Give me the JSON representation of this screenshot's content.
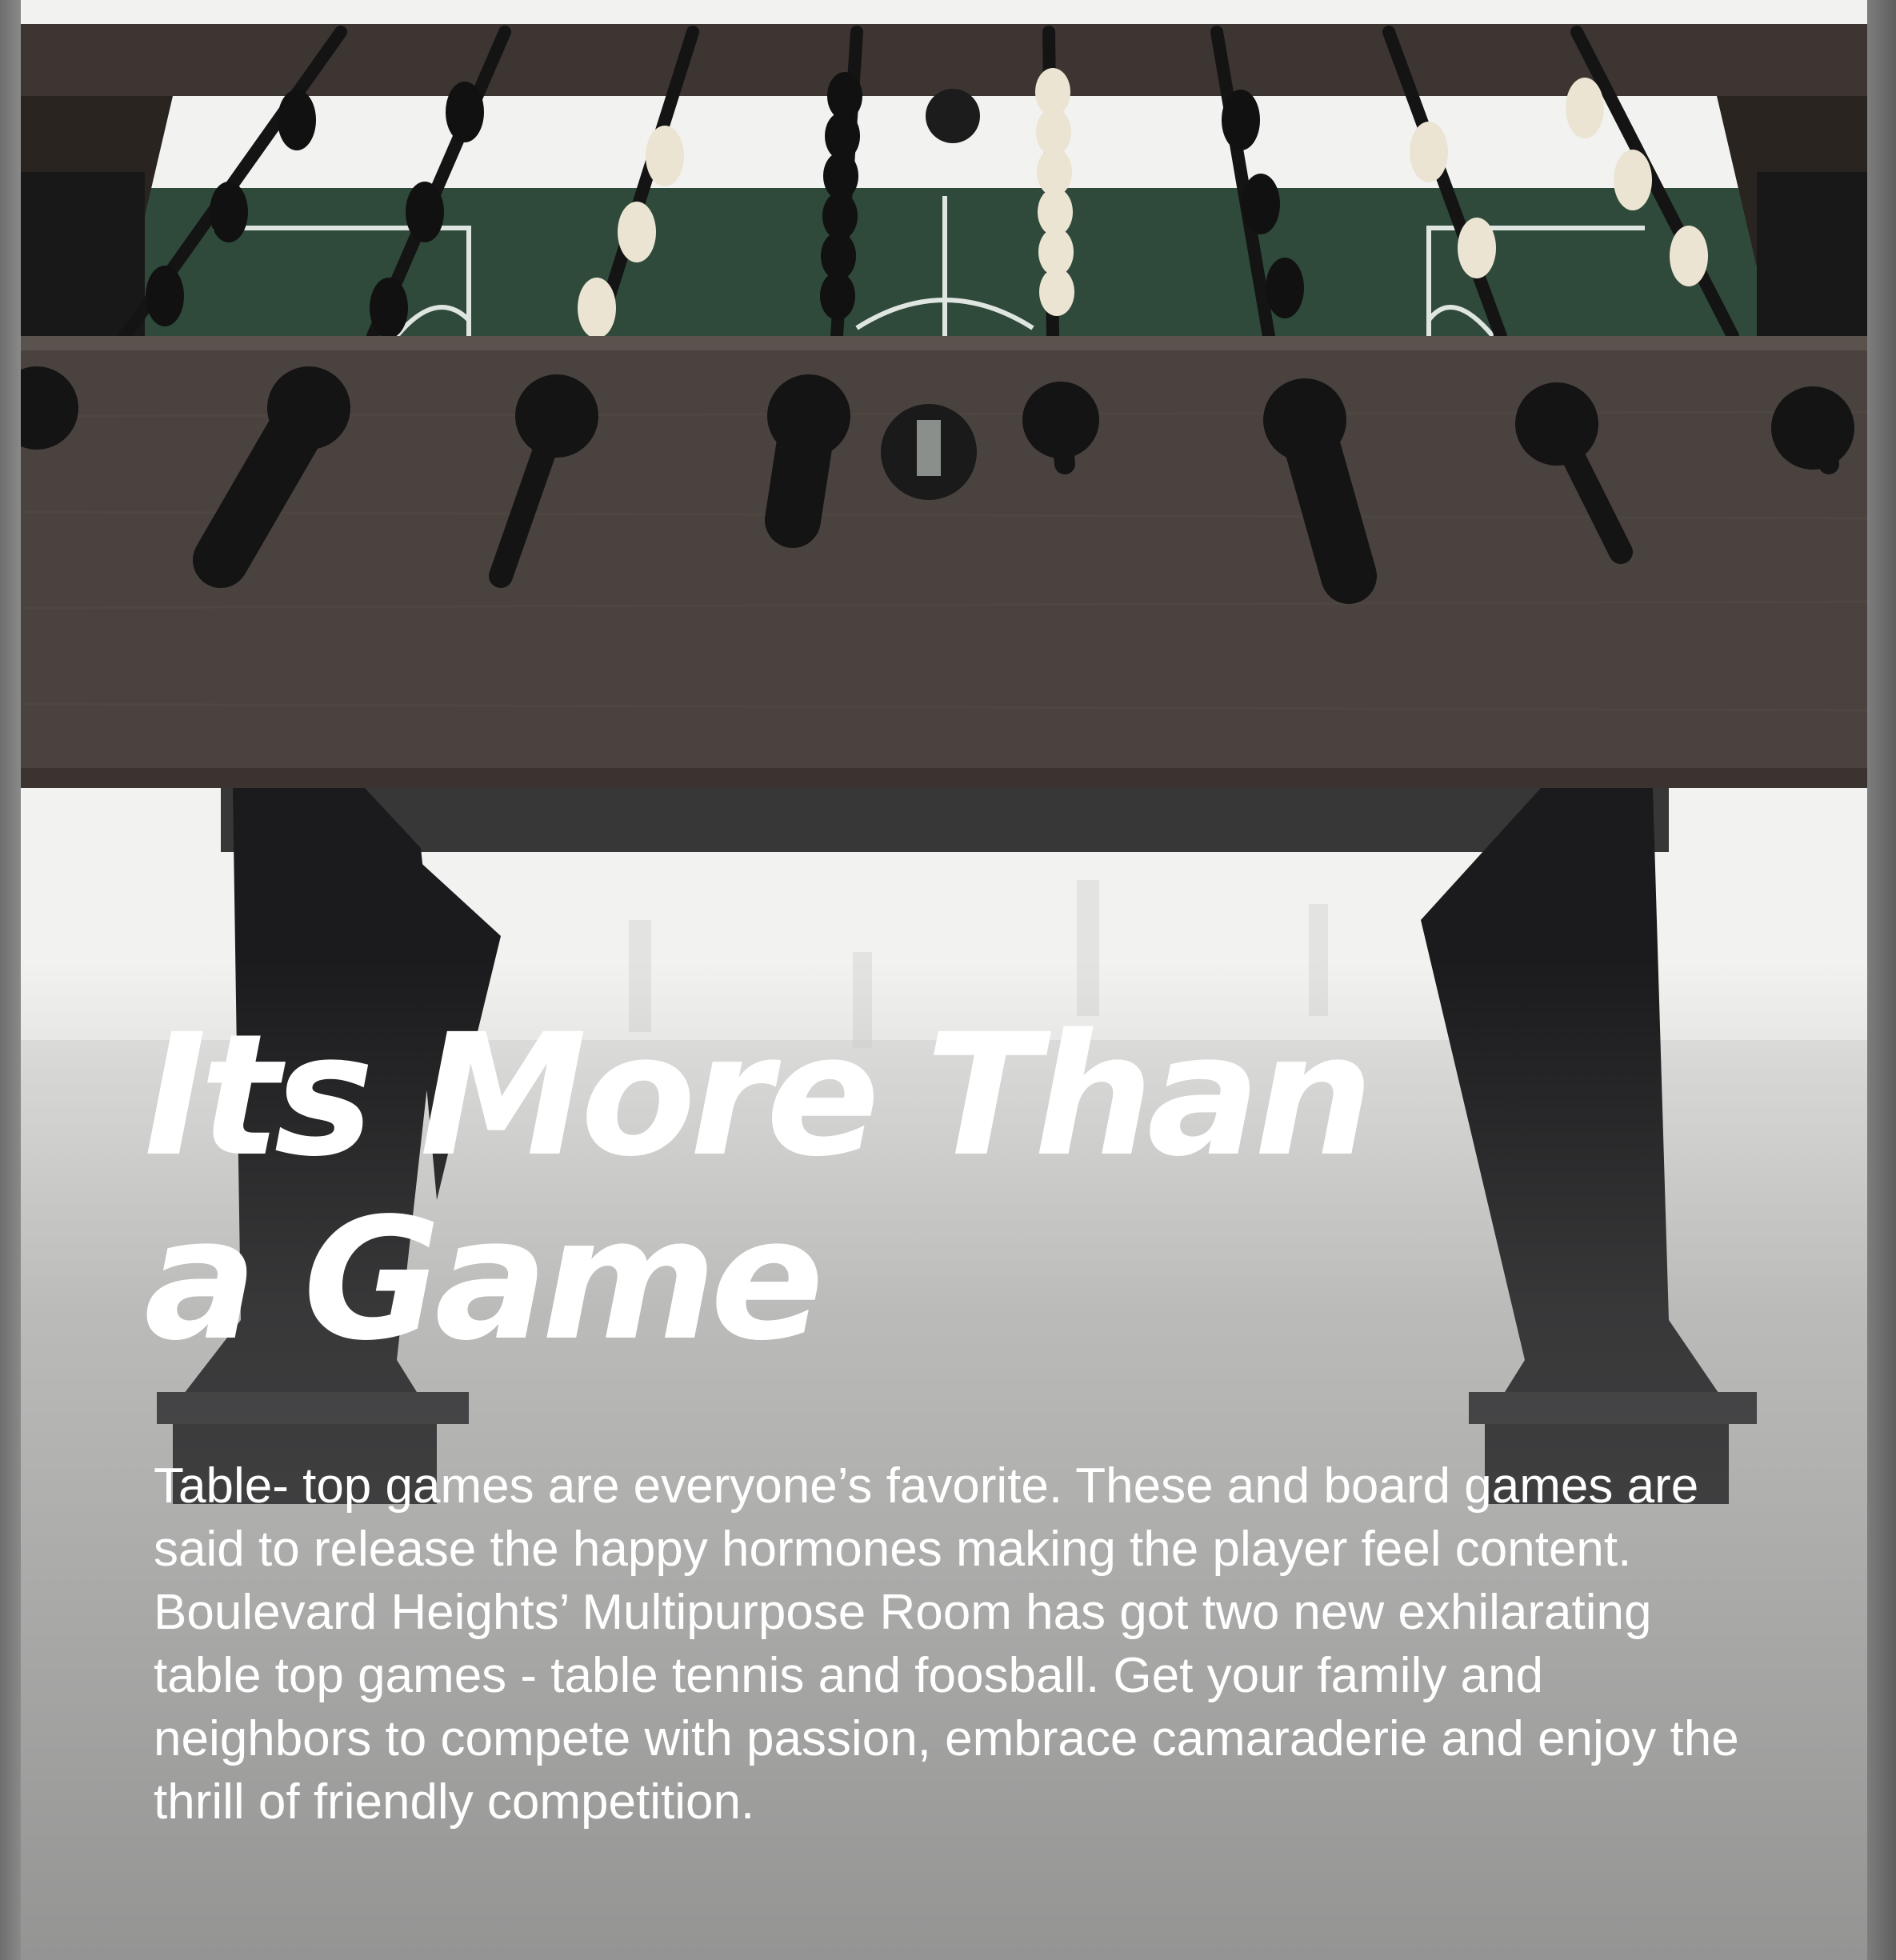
{
  "headline": {
    "line1": "Its More Than",
    "line2": "a Game"
  },
  "body": {
    "text": "Table- top games are everyone’s favorite. These and board games are said to release the happy hormones making the player feel content. Boulevard Heights’ Multipurpose Room has got two new exhilarating table top games - table tennis and foosball. Get your family and neighbors to compete with passion, embrace camaraderie and enjoy the thrill of friendly competition."
  },
  "colors": {
    "text": "#ffffff",
    "cabinet": "#4a423e",
    "field": "#2f4a3a",
    "legs": "#1b1b1d",
    "floor": "#efefed",
    "player_dark": "#111111",
    "player_light": "#ebe4d2"
  }
}
